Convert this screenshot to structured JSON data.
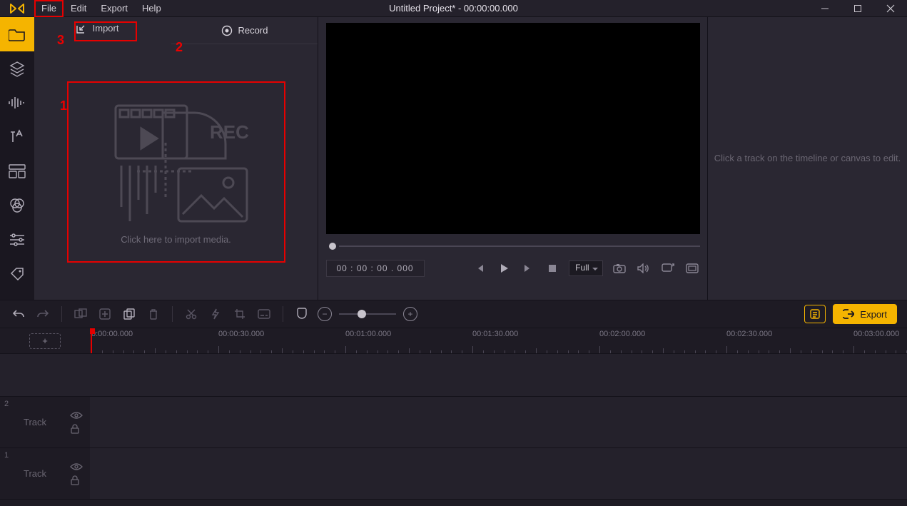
{
  "title": "Untitled Project* - 00:00:00.000",
  "menu": {
    "file": "File",
    "edit": "Edit",
    "export": "Export",
    "help": "Help"
  },
  "annot": {
    "n1": "1",
    "n2": "2",
    "n3": "3"
  },
  "media": {
    "import": "Import",
    "record": "Record",
    "drop": "Click here to import media.",
    "rec_art": "REC"
  },
  "preview": {
    "timecode": "00 : 00 : 00 . 000",
    "zoom": "Full"
  },
  "props": {
    "hint": "Click a track on the timeline or canvas to edit."
  },
  "toolbar": {
    "export": "Export"
  },
  "ruler": [
    "0:00:00.000",
    "00:00:30.000",
    "00:01:00.000",
    "00:01:30.000",
    "00:02:00.000",
    "00:02:30.000",
    "00:03:00.000"
  ],
  "tracks": [
    {
      "num": "2",
      "label": "Track"
    },
    {
      "num": "1",
      "label": "Track"
    }
  ]
}
